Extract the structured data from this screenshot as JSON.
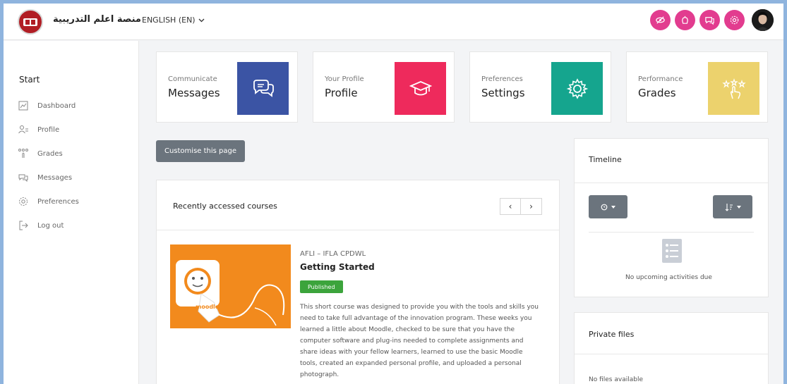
{
  "header": {
    "site_name": "منصة اعلم التدريبية",
    "language": "ENGLISH (EN)",
    "icons": [
      "eye-slash-icon",
      "hand-icon",
      "chat-icon",
      "gear-icon"
    ],
    "accent_color": "#e23c8f"
  },
  "sidebar": {
    "title": "Start",
    "items": [
      {
        "label": "Dashboard",
        "icon": "dashboard-icon"
      },
      {
        "label": "Profile",
        "icon": "profile-icon"
      },
      {
        "label": "Grades",
        "icon": "grades-icon"
      },
      {
        "label": "Messages",
        "icon": "messages-icon"
      },
      {
        "label": "Preferences",
        "icon": "preferences-icon"
      },
      {
        "label": "Log out",
        "icon": "logout-icon"
      }
    ]
  },
  "tiles": [
    {
      "subtitle": "Communicate",
      "title": "Messages",
      "icon": "messages-icon",
      "color": "#3b54a4"
    },
    {
      "subtitle": "Your Profile",
      "title": "Profile",
      "icon": "graduation-cap-icon",
      "color": "#ee2a5c"
    },
    {
      "subtitle": "Preferences",
      "title": "Settings",
      "icon": "gear-icon",
      "color": "#15a58e"
    },
    {
      "subtitle": "Performance",
      "title": "Grades",
      "icon": "stars-hand-icon",
      "color": "#ecd26d"
    }
  ],
  "customise_label": "Customise this page",
  "recent": {
    "title": "Recently accessed courses",
    "prev": "‹",
    "next": "›",
    "course": {
      "category": "AFLI – IFLA CPDWL",
      "name": "Getting Started",
      "badge": "Published",
      "image_label": "moodle",
      "description": "This short course was designed to provide you with the tools and skills you need to take full advantage of the innovation program. These weeks you learned a little about Moodle, checked to be sure that you have the computer software and plug-ins needed to complete assignments and share ideas with your fellow learners, learned to use the basic Moodle tools, created an expanded personal profile, and uploaded a personal photograph."
    }
  },
  "timeline": {
    "title": "Timeline",
    "empty": "No upcoming activities due"
  },
  "private_files": {
    "title": "Private files",
    "empty": "No files available"
  }
}
